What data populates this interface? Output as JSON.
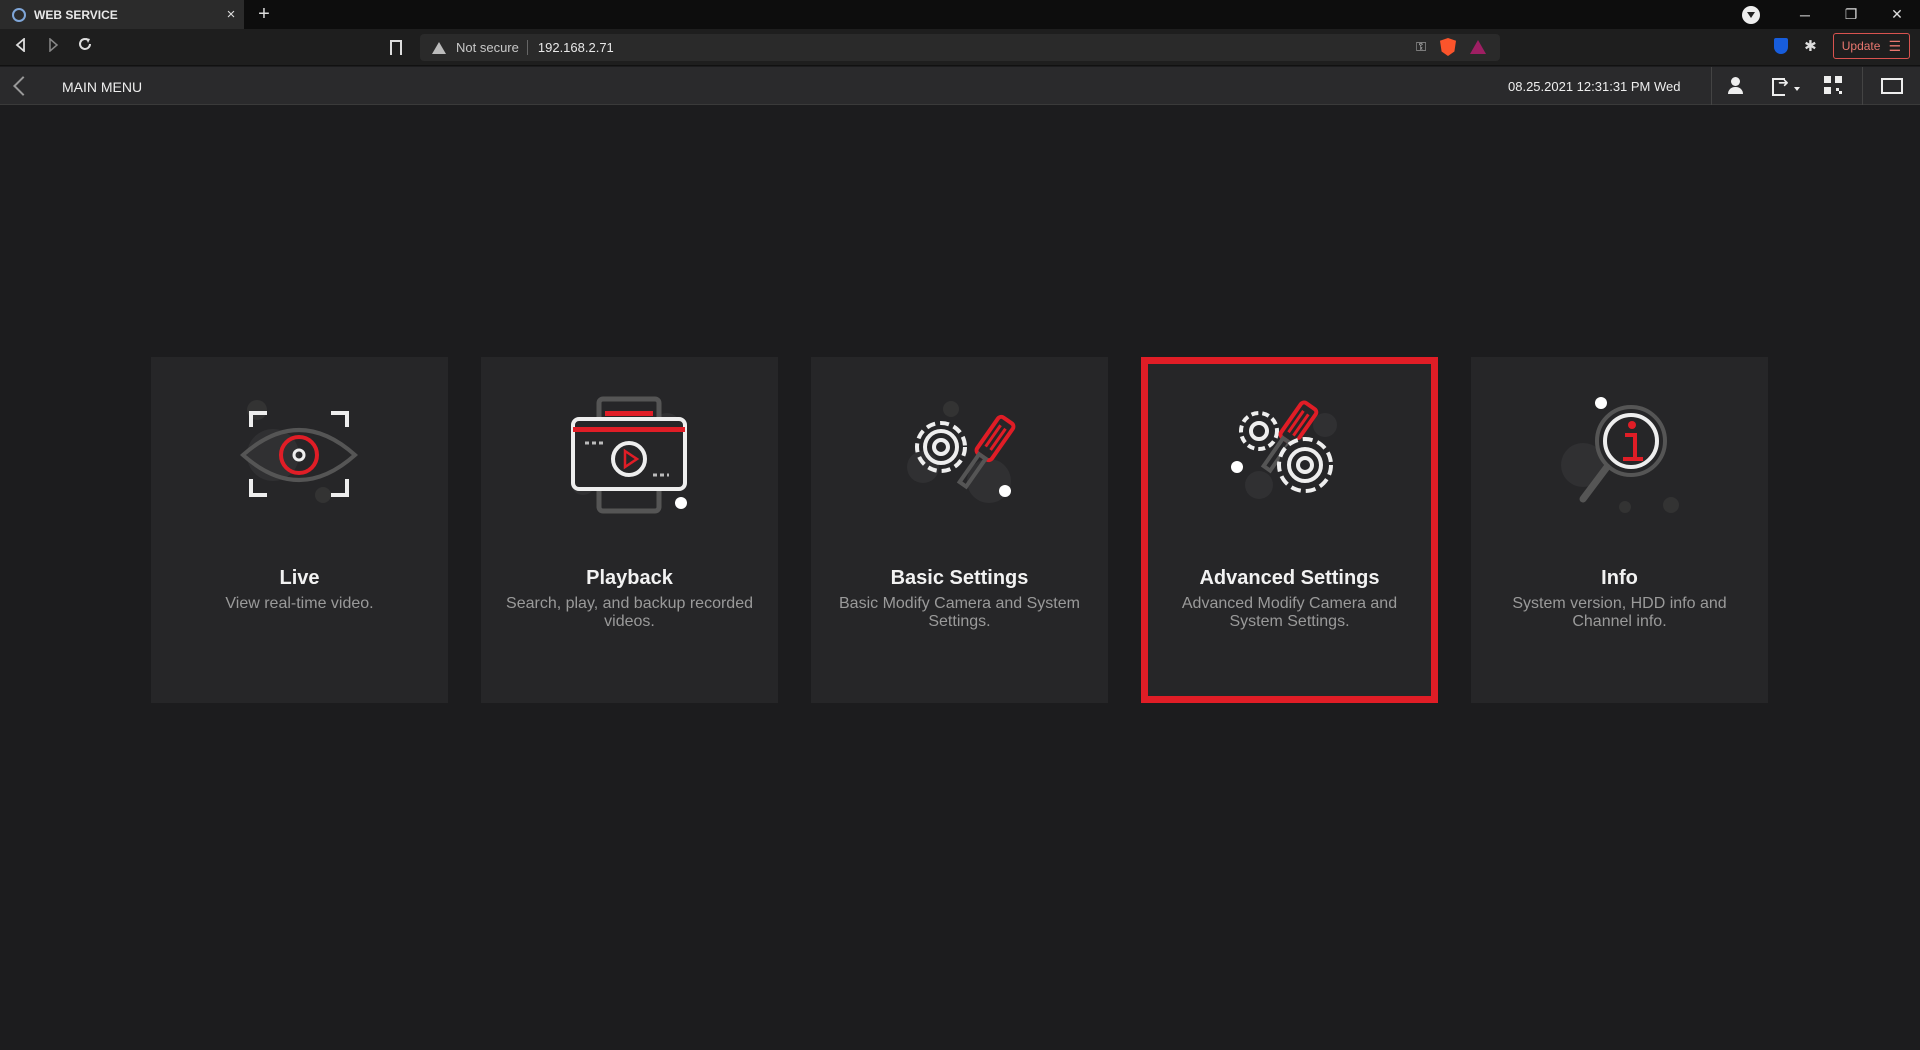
{
  "browser": {
    "tab_title": "WEB SERVICE",
    "tab_close": "×",
    "new_tab": "+",
    "security_label": "Not secure",
    "url": "192.168.2.71",
    "update_label": "Update",
    "icons": [
      "back-icon",
      "forward-icon",
      "reload-icon",
      "bookmark-icon",
      "warning-icon",
      "key-icon",
      "brave-shields-icon",
      "brave-rewards-icon",
      "bitwarden-icon",
      "extensions-icon",
      "menu-icon"
    ]
  },
  "window": {
    "minimize": "─",
    "restore": "❐",
    "close": "✕"
  },
  "header": {
    "title": "MAIN MENU",
    "datetime": "08.25.2021 12:31:31 PM Wed",
    "icons": [
      "back-arrow-icon",
      "user-icon",
      "logout-icon",
      "qr-code-icon",
      "monitor-icon"
    ]
  },
  "accent_color": "#e01d26",
  "cards": [
    {
      "title": "Live",
      "desc": "View real-time video.",
      "icon": "eye-icon",
      "selected": false
    },
    {
      "title": "Playback",
      "desc": "Search, play, and backup recorded videos.",
      "icon": "film-playback-icon",
      "selected": false
    },
    {
      "title": "Basic Settings",
      "desc": "Basic Modify Camera and System Settings.",
      "icon": "gear-screwdriver-icon",
      "selected": false
    },
    {
      "title": "Advanced Settings",
      "desc": "Advanced Modify Camera and System Settings.",
      "icon": "gears-screwdriver-icon",
      "selected": true
    },
    {
      "title": "Info",
      "desc": "System version, HDD info and Channel info.",
      "icon": "info-magnifier-icon",
      "selected": false
    }
  ]
}
